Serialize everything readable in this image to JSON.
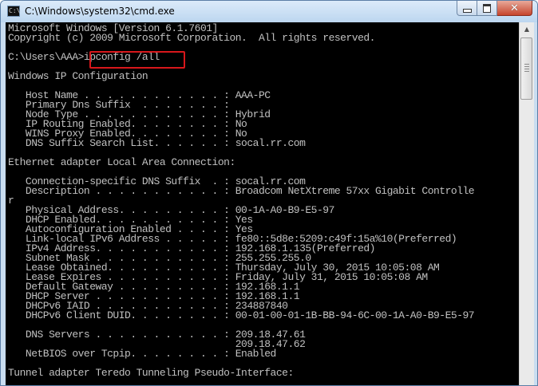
{
  "window": {
    "title": "C:\\Windows\\system32\\cmd.exe",
    "icon": "cmd-icon",
    "min_icon": "minimize-icon",
    "max_icon": "maximize-icon",
    "close_icon": "close-icon",
    "close_glyph": "✕",
    "icon_glyph": "C:\\"
  },
  "console": {
    "lines": [
      "Microsoft Windows [Version 6.1.7601]",
      "Copyright (c) 2009 Microsoft Corporation.  All rights reserved.",
      "",
      "C:\\Users\\AAA>ipconfig /all",
      "",
      "Windows IP Configuration",
      "",
      "   Host Name . . . . . . . . . . . . : AAA-PC",
      "   Primary Dns Suffix  . . . . . . . :",
      "   Node Type . . . . . . . . . . . . : Hybrid",
      "   IP Routing Enabled. . . . . . . . : No",
      "   WINS Proxy Enabled. . . . . . . . : No",
      "   DNS Suffix Search List. . . . . . : socal.rr.com",
      "",
      "Ethernet adapter Local Area Connection:",
      "",
      "   Connection-specific DNS Suffix  . : socal.rr.com",
      "   Description . . . . . . . . . . . : Broadcom NetXtreme 57xx Gigabit Controlle",
      "r",
      "   Physical Address. . . . . . . . . : 00-1A-A0-B9-E5-97",
      "   DHCP Enabled. . . . . . . . . . . : Yes",
      "   Autoconfiguration Enabled . . . . : Yes",
      "   Link-local IPv6 Address . . . . . : fe80::5d8e:5209:c49f:15a%10(Preferred)",
      "   IPv4 Address. . . . . . . . . . . : 192.168.1.135(Preferred)",
      "   Subnet Mask . . . . . . . . . . . : 255.255.255.0",
      "   Lease Obtained. . . . . . . . . . : Thursday, July 30, 2015 10:05:08 AM",
      "   Lease Expires . . . . . . . . . . : Friday, July 31, 2015 10:05:08 AM",
      "   Default Gateway . . . . . . . . . : 192.168.1.1",
      "   DHCP Server . . . . . . . . . . . : 192.168.1.1",
      "   DHCPv6 IAID . . . . . . . . . . . : 234887840",
      "   DHCPv6 Client DUID. . . . . . . . : 00-01-00-01-1B-BB-94-6C-00-1A-A0-B9-E5-97",
      "",
      "   DNS Servers . . . . . . . . . . . : 209.18.47.61",
      "                                       209.18.47.62",
      "   NetBIOS over Tcpip. . . . . . . . : Enabled",
      "",
      "Tunnel adapter Teredo Tunneling Pseudo-Interface:"
    ],
    "highlighted_command": "ipconfig /all",
    "text_color": "#c0c0c0",
    "background_color": "#000000",
    "highlight_color": "#d8171b"
  },
  "scrollbar": {
    "up_arrow_icon": "scroll-up-arrow-icon",
    "up_glyph": "▲"
  }
}
